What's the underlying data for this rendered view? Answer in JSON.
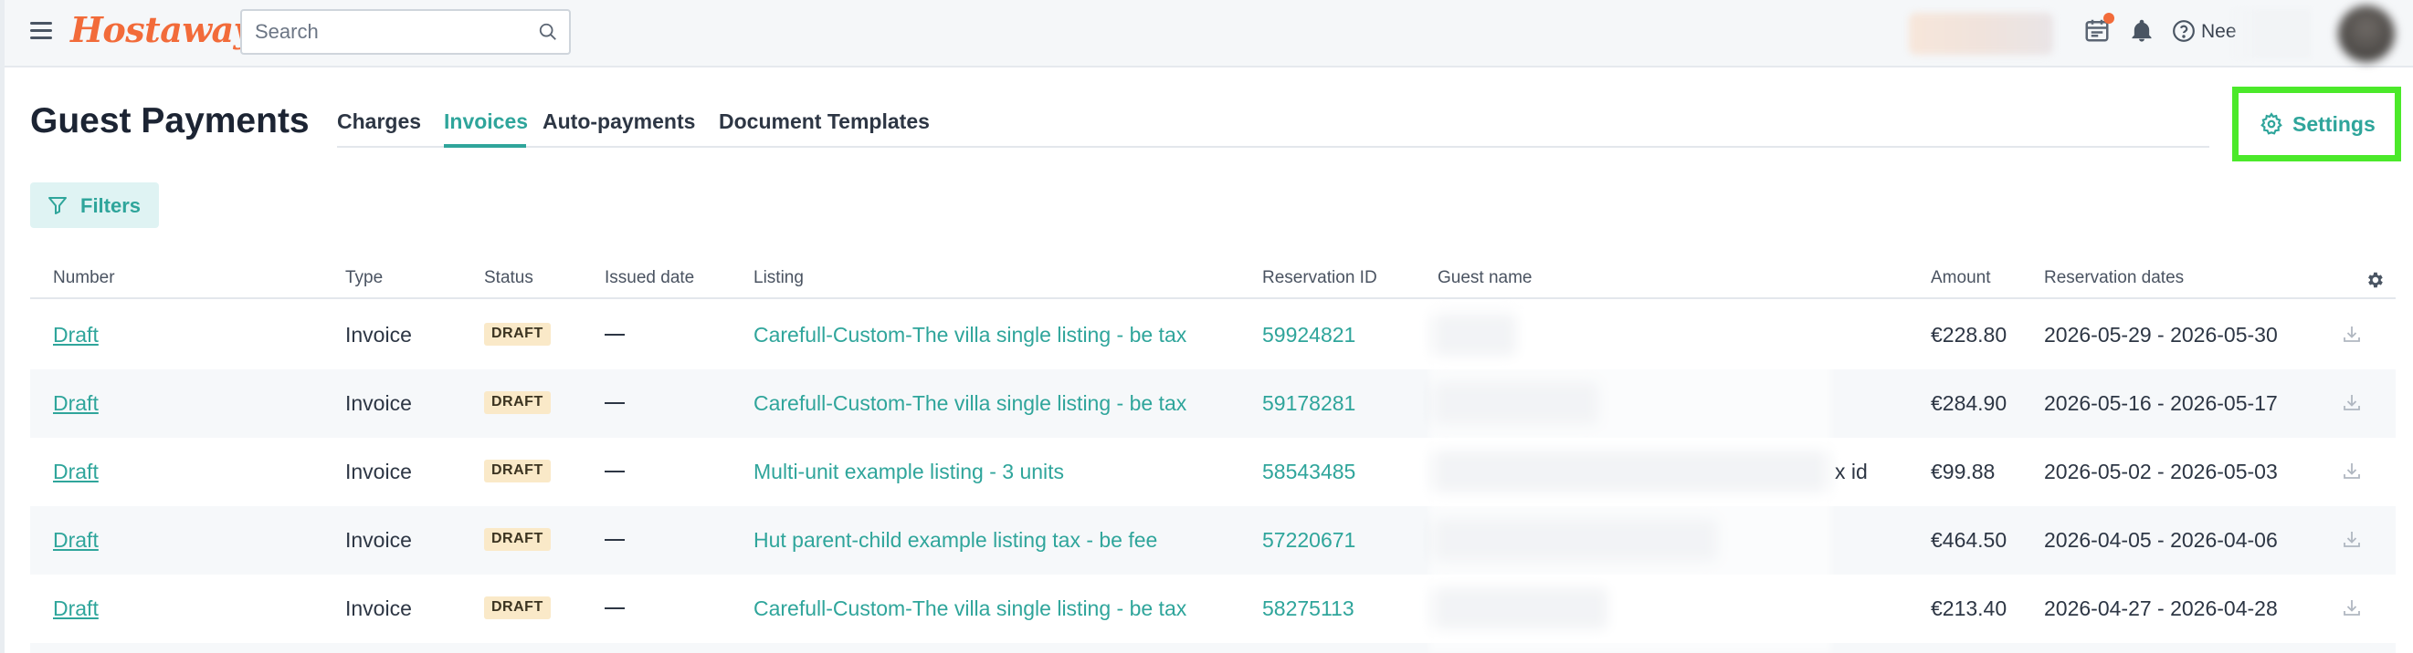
{
  "topbar": {
    "brand": "Hostaway",
    "search_placeholder": "Search",
    "help_label": "Nee"
  },
  "header": {
    "title": "Guest Payments",
    "tabs": [
      {
        "label": "Charges"
      },
      {
        "label": "Invoices",
        "active": true
      },
      {
        "label": "Auto-payments"
      },
      {
        "label": "Document Templates"
      }
    ],
    "settings_label": "Settings",
    "filters_label": "Filters"
  },
  "table": {
    "columns": [
      "Number",
      "Type",
      "Status",
      "Issued date",
      "Listing",
      "Reservation ID",
      "Guest name",
      "Amount",
      "Reservation dates"
    ],
    "rows": [
      {
        "number": "Draft",
        "type": "Invoice",
        "status": "DRAFT",
        "listing": "Carefull-Custom-The villa single listing - be tax",
        "reservation_id": "59924821",
        "guest_suffix": "",
        "amount": "€228.80",
        "dates": "2026-05-29 - 2026-05-30"
      },
      {
        "number": "Draft",
        "type": "Invoice",
        "status": "DRAFT",
        "listing": "Carefull-Custom-The villa single listing - be tax",
        "reservation_id": "59178281",
        "guest_suffix": "",
        "amount": "€284.90",
        "dates": "2026-05-16 - 2026-05-17"
      },
      {
        "number": "Draft",
        "type": "Invoice",
        "status": "DRAFT",
        "listing": "Multi-unit example listing - 3 units",
        "reservation_id": "58543485",
        "guest_suffix": "x id",
        "amount": "€99.88",
        "dates": "2026-05-02 - 2026-05-03"
      },
      {
        "number": "Draft",
        "type": "Invoice",
        "status": "DRAFT",
        "listing": "Hut parent-child example listing tax - be fee",
        "reservation_id": "57220671",
        "guest_suffix": "",
        "amount": "€464.50",
        "dates": "2026-04-05 - 2026-04-06"
      },
      {
        "number": "Draft",
        "type": "Invoice",
        "status": "DRAFT",
        "listing": "Carefull-Custom-The villa single listing - be tax",
        "reservation_id": "58275113",
        "guest_suffix": "",
        "amount": "€213.40",
        "dates": "2026-04-27 - 2026-04-28"
      }
    ]
  },
  "colors": {
    "accent": "#2fa59b",
    "brand": "#f26b3a",
    "highlight": "#4be92a",
    "draft_badge_bg": "#fae9c8"
  }
}
